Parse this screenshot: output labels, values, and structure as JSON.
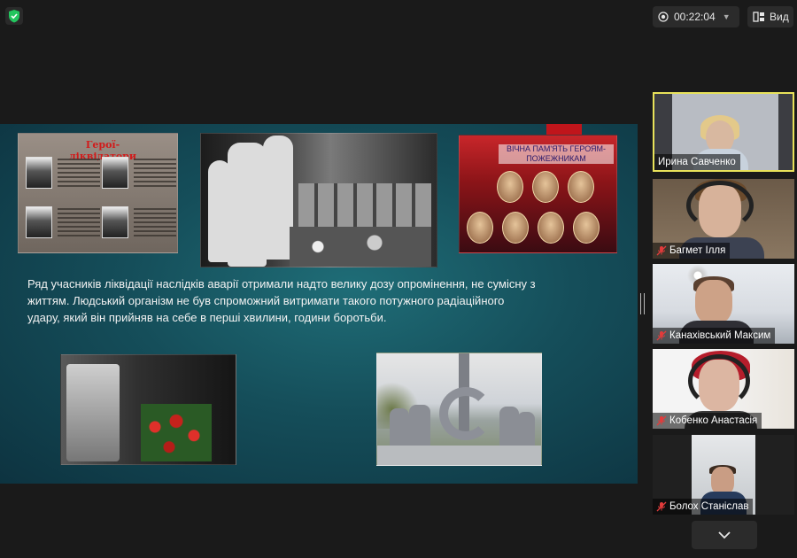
{
  "toolbar": {
    "timer": "00:22:04",
    "view_label": "Вид",
    "colors": {
      "shield": "#23c55e",
      "timer_dot": "#e6e6e6"
    }
  },
  "slide": {
    "photo1_title": "Герої-ліквідатори",
    "photo3_caption": "ВІЧНА ПАМ'ЯТЬ ГЕРОЯМ-ПОЖЕЖНИКАМ",
    "paragraph_line1": "Ряд учасників ліквідації наслідків  аварії отримали надто велику дозу опромінення, не сумісну з",
    "paragraph_line2": "життям. Людський організм не був спроможний витримати такого потужного радіаційного",
    "paragraph_line3": "удару, який він прийняв на себе в перші хвилини, години  боротьби."
  },
  "participants": [
    {
      "name": "Ирина Савченко",
      "active": true,
      "muted": false
    },
    {
      "name": "Багмет Ілля",
      "active": false,
      "muted": true
    },
    {
      "name": "Канахівський Максим",
      "active": false,
      "muted": true
    },
    {
      "name": "Кобенко Анастасія",
      "active": false,
      "muted": true
    },
    {
      "name": "Болох Станіслав",
      "active": false,
      "muted": true
    }
  ],
  "colors": {
    "active_border": "#e8e25a",
    "muted_mic": "#e23b3b",
    "slide_accent": "#c0151b"
  }
}
